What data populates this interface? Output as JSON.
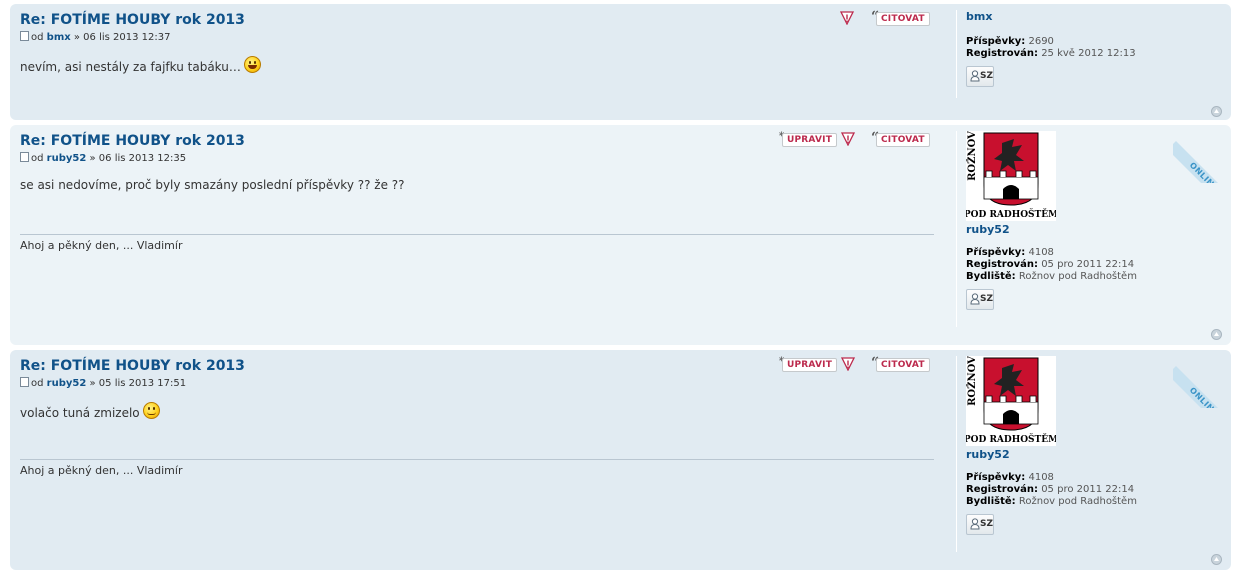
{
  "posts": [
    {
      "title": "Re: FOTÍME HOUBY rok 2013",
      "author_prefix": "od",
      "author": "bmx",
      "date": "» 06 lis 2013 12:37",
      "content": "nevím, asi nestály za fajfku tabáku…",
      "smiley": "laughing",
      "buttons": {
        "report_icon": "warning-icon",
        "quote": "CITOVAT"
      },
      "profile": {
        "name": "bmx",
        "posts_label": "Příspěvky:",
        "posts": "2690",
        "registered_label": "Registrován:",
        "registered": "25 kvě 2012 12:13",
        "pm": "SZ"
      }
    },
    {
      "title": "Re: FOTÍME HOUBY rok 2013",
      "author_prefix": "od",
      "author": "ruby52",
      "date": "» 06 lis 2013 12:35",
      "content": "se asi nedovíme, proč byly smazány poslední příspěvky ?? že ??",
      "signature": "Ahoj a pěkný den, ... Vladimír",
      "buttons": {
        "edit": "UPRAVIT",
        "report_icon": "warning-icon",
        "quote": "CITOVAT"
      },
      "online": "ONLINE",
      "profile": {
        "avatar_top_text": "ROŽNOV",
        "avatar_bottom_text": "POD RADHOŠTĚM",
        "name": "ruby52",
        "posts_label": "Příspěvky:",
        "posts": "4108",
        "registered_label": "Registrován:",
        "registered": "05 pro 2011 22:14",
        "location_label": "Bydliště:",
        "location": "Rožnov pod Radhoštěm",
        "pm": "SZ"
      }
    },
    {
      "title": "Re: FOTÍME HOUBY rok 2013",
      "author_prefix": "od",
      "author": "ruby52",
      "date": "» 05 lis 2013 17:51",
      "content": "volačo tuná zmizelo",
      "smiley": "wink",
      "signature": "Ahoj a pěkný den, ... Vladimír",
      "buttons": {
        "edit": "UPRAVIT",
        "report_icon": "warning-icon",
        "quote": "CITOVAT"
      },
      "online": "ONLINE",
      "profile": {
        "avatar_top_text": "ROŽNOV",
        "avatar_bottom_text": "POD RADHOŠTĚM",
        "name": "ruby52",
        "posts_label": "Příspěvky:",
        "posts": "4108",
        "registered_label": "Registrován:",
        "registered": "05 pro 2011 22:14",
        "location_label": "Bydliště:",
        "location": "Rožnov pod Radhoštěm",
        "pm": "SZ"
      }
    }
  ],
  "colors": {
    "bg1": "#e1ebf2",
    "bg2": "#ecf3f7",
    "title": "#105289",
    "button_text": "#bc2a4d"
  }
}
